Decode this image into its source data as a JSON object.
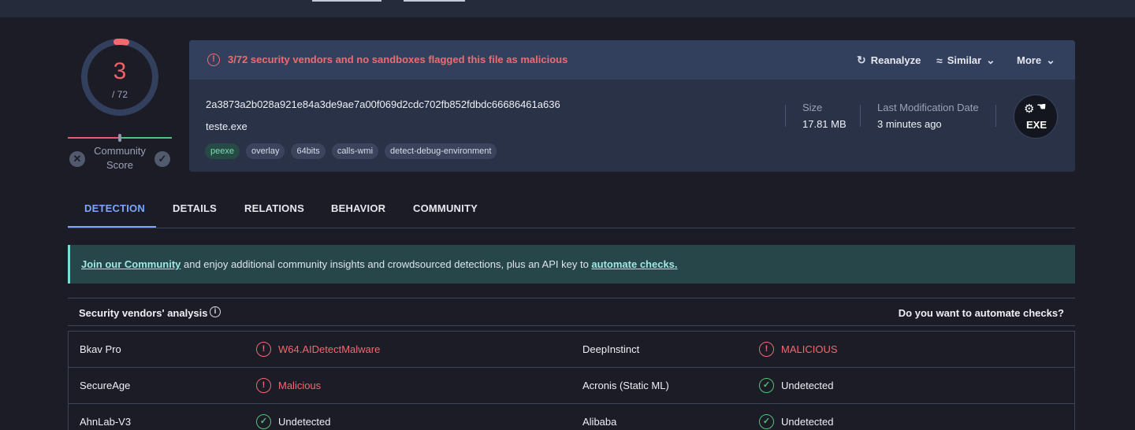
{
  "score": {
    "detections": "3",
    "total": "/ 72",
    "community_label": "Community Score"
  },
  "summary": {
    "alert": "3/72 security vendors and no sandboxes flagged this file as malicious",
    "actions": [
      {
        "label": "Reanalyze",
        "icon": "refresh-icon"
      },
      {
        "label": "Similar",
        "icon": "similar-icon"
      },
      {
        "label": "More",
        "icon": "chevron-down-icon"
      }
    ],
    "hash": "2a3873a2b028a921e84a3de9ae7a00f069d2cdc702fb852fdbdc66686461a636",
    "filename": "teste.exe",
    "tags": [
      "peexe",
      "overlay",
      "64bits",
      "calls-wmi",
      "detect-debug-environment"
    ],
    "size_label": "Size",
    "size_value": "17.81 MB",
    "modified_label": "Last Modification Date",
    "modified_value": "3 minutes ago",
    "filetype": "EXE"
  },
  "tabs": [
    "DETECTION",
    "DETAILS",
    "RELATIONS",
    "BEHAVIOR",
    "COMMUNITY"
  ],
  "banner": {
    "link1": "Join our Community",
    "middle": " and enjoy additional community insights and crowdsourced detections, plus an API key to ",
    "link2": "automate checks."
  },
  "vendors": {
    "title": "Security vendors' analysis",
    "automate": "Do you want to automate checks?",
    "rows": [
      {
        "left_name": "Bkav Pro",
        "left_result": "W64.AIDetectMalware",
        "left_status": "malicious",
        "right_name": "DeepInstinct",
        "right_result": "MALICIOUS",
        "right_status": "malicious"
      },
      {
        "left_name": "SecureAge",
        "left_result": "Malicious",
        "left_status": "malicious",
        "right_name": "Acronis (Static ML)",
        "right_result": "Undetected",
        "right_status": "undetected"
      },
      {
        "left_name": "AhnLab-V3",
        "left_result": "Undetected",
        "left_status": "undetected",
        "right_name": "Alibaba",
        "right_result": "Undetected",
        "right_status": "undetected"
      }
    ]
  },
  "colors": {
    "malicious": "#f06a6f",
    "undetected": "#56c17a",
    "accent": "#7da7ff"
  }
}
